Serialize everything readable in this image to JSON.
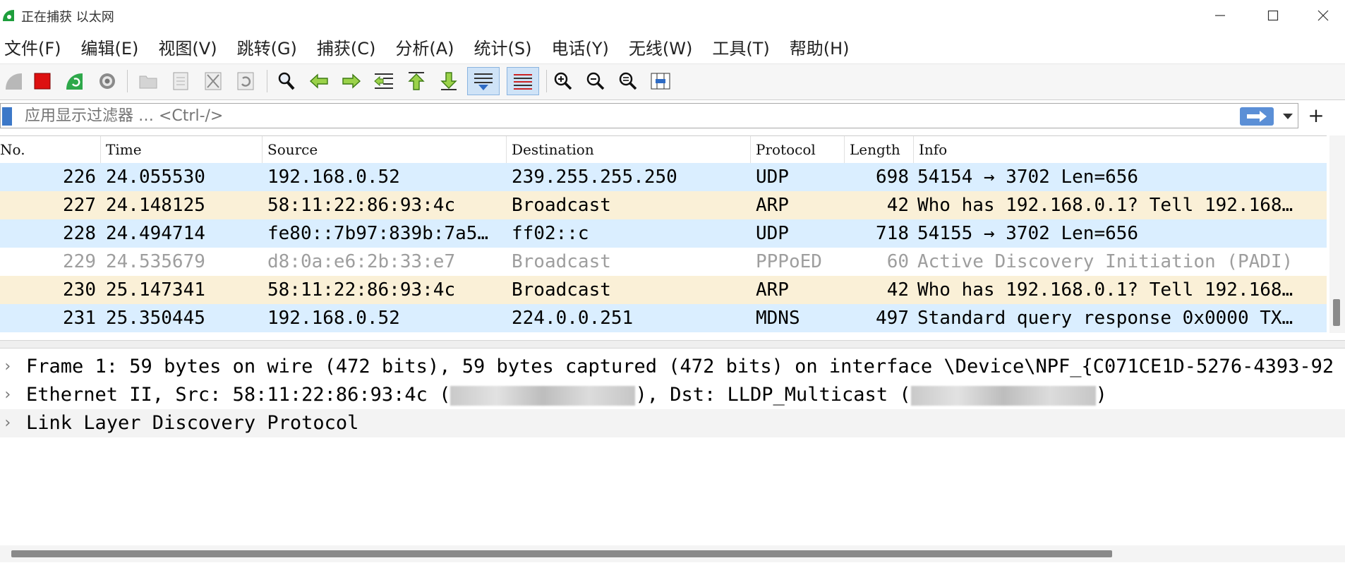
{
  "window": {
    "title": "正在捕获 以太网",
    "minimize": "—",
    "maximize": "☐",
    "close": "✕"
  },
  "menu": [
    "文件(F)",
    "编辑(E)",
    "视图(V)",
    "跳转(G)",
    "捕获(C)",
    "分析(A)",
    "统计(S)",
    "电话(Y)",
    "无线(W)",
    "工具(T)",
    "帮助(H)"
  ],
  "toolbar": {
    "icons": [
      "start-capture-icon",
      "stop-capture-icon",
      "restart-capture-icon",
      "capture-options-icon",
      "open-file-icon",
      "save-file-icon",
      "close-file-icon",
      "reload-file-icon",
      "find-packet-icon",
      "go-back-icon",
      "go-forward-icon",
      "go-to-packet-icon",
      "go-first-icon",
      "go-last-icon",
      "autoscroll-icon",
      "colorize-icon",
      "zoom-in-icon",
      "zoom-out-icon",
      "zoom-normal-icon",
      "resize-columns-icon"
    ],
    "active": [
      "autoscroll-icon",
      "colorize-icon"
    ]
  },
  "filter": {
    "placeholder": "应用显示过滤器 … <Ctrl-/>",
    "value": "",
    "add": "+"
  },
  "columns": [
    "No.",
    "Time",
    "Source",
    "Destination",
    "Protocol",
    "Length",
    "Info"
  ],
  "colors": {
    "udp": "#daeeff",
    "arp": "#faf0d7",
    "pppoed": "#ffffff",
    "pppoed_text": "#9e9e9e"
  },
  "packets": [
    {
      "no": "226",
      "time": "24.055530",
      "source": "192.168.0.52",
      "destination": "239.255.255.250",
      "protocol": "UDP",
      "length": "698",
      "info": "54154 → 3702 Len=656",
      "bg": "#daeeff",
      "fg": "#000000"
    },
    {
      "no": "227",
      "time": "24.148125",
      "source": "58:11:22:86:93:4c",
      "destination": "Broadcast",
      "protocol": "ARP",
      "length": "42",
      "info": "Who has 192.168.0.1? Tell 192.168…",
      "bg": "#faf0d7",
      "fg": "#000000"
    },
    {
      "no": "228",
      "time": "24.494714",
      "source": "fe80::7b97:839b:7a5…",
      "destination": "ff02::c",
      "protocol": "UDP",
      "length": "718",
      "info": "54155 → 3702 Len=656",
      "bg": "#daeeff",
      "fg": "#000000"
    },
    {
      "no": "229",
      "time": "24.535679",
      "source": "d8:0a:e6:2b:33:e7",
      "destination": "Broadcast",
      "protocol": "PPPoED",
      "length": "60",
      "info": "Active Discovery Initiation (PADI)",
      "bg": "#ffffff",
      "fg": "#9e9e9e"
    },
    {
      "no": "230",
      "time": "25.147341",
      "source": "58:11:22:86:93:4c",
      "destination": "Broadcast",
      "protocol": "ARP",
      "length": "42",
      "info": "Who has 192.168.0.1? Tell 192.168…",
      "bg": "#faf0d7",
      "fg": "#000000"
    },
    {
      "no": "231",
      "time": "25.350445",
      "source": "192.168.0.52",
      "destination": "224.0.0.251",
      "protocol": "MDNS",
      "length": "497",
      "info": "Standard query response 0x0000 TX…",
      "bg": "#daeeff",
      "fg": "#000000"
    }
  ],
  "details": [
    {
      "text": "Frame 1: 59 bytes on wire (472 bits), 59 bytes captured (472 bits) on interface \\Device\\NPF_{C071CE1D-5276-4393-92",
      "expander": "›"
    },
    {
      "pre": "Ethernet II, Src: 58:11:22:86:93:4c (",
      "mid": "), Dst: LLDP_Multicast (",
      "post": ")",
      "expander": "›"
    },
    {
      "text": "Link Layer Discovery Protocol",
      "expander": "›"
    }
  ]
}
